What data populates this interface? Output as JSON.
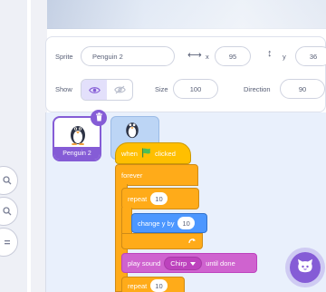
{
  "sprite_info": {
    "sprite_label": "Sprite",
    "sprite_name": "Penguin 2",
    "x_label": "x",
    "x_value": "95",
    "y_label": "y",
    "y_value": "36",
    "show_label": "Show",
    "size_label": "Size",
    "size_value": "100",
    "direction_label": "Direction",
    "direction_value": "90"
  },
  "sprites": [
    {
      "name": "Penguin 2",
      "selected": true
    },
    {
      "name": "",
      "selected": false
    }
  ],
  "zoom_controls": [
    "zoom-in-icon",
    "zoom-out-icon",
    "zoom-reset-icon"
  ],
  "script": {
    "when_label": "when",
    "clicked_label": "clicked",
    "forever_label": "forever",
    "repeat_label": "repeat",
    "repeat_value": "10",
    "change_y_label": "change y by",
    "change_y_value": "10",
    "play_sound_label": "play sound",
    "sound_name": "Chirp",
    "until_done_label": "until done",
    "repeat2_label": "repeat",
    "repeat2_value": "10"
  },
  "colors": {
    "accent": "#855cd6",
    "events": "#ffbf00",
    "control": "#ffab19",
    "motion": "#4c97ff",
    "sound": "#cf63cf",
    "go_flag": "#4cbf56"
  }
}
